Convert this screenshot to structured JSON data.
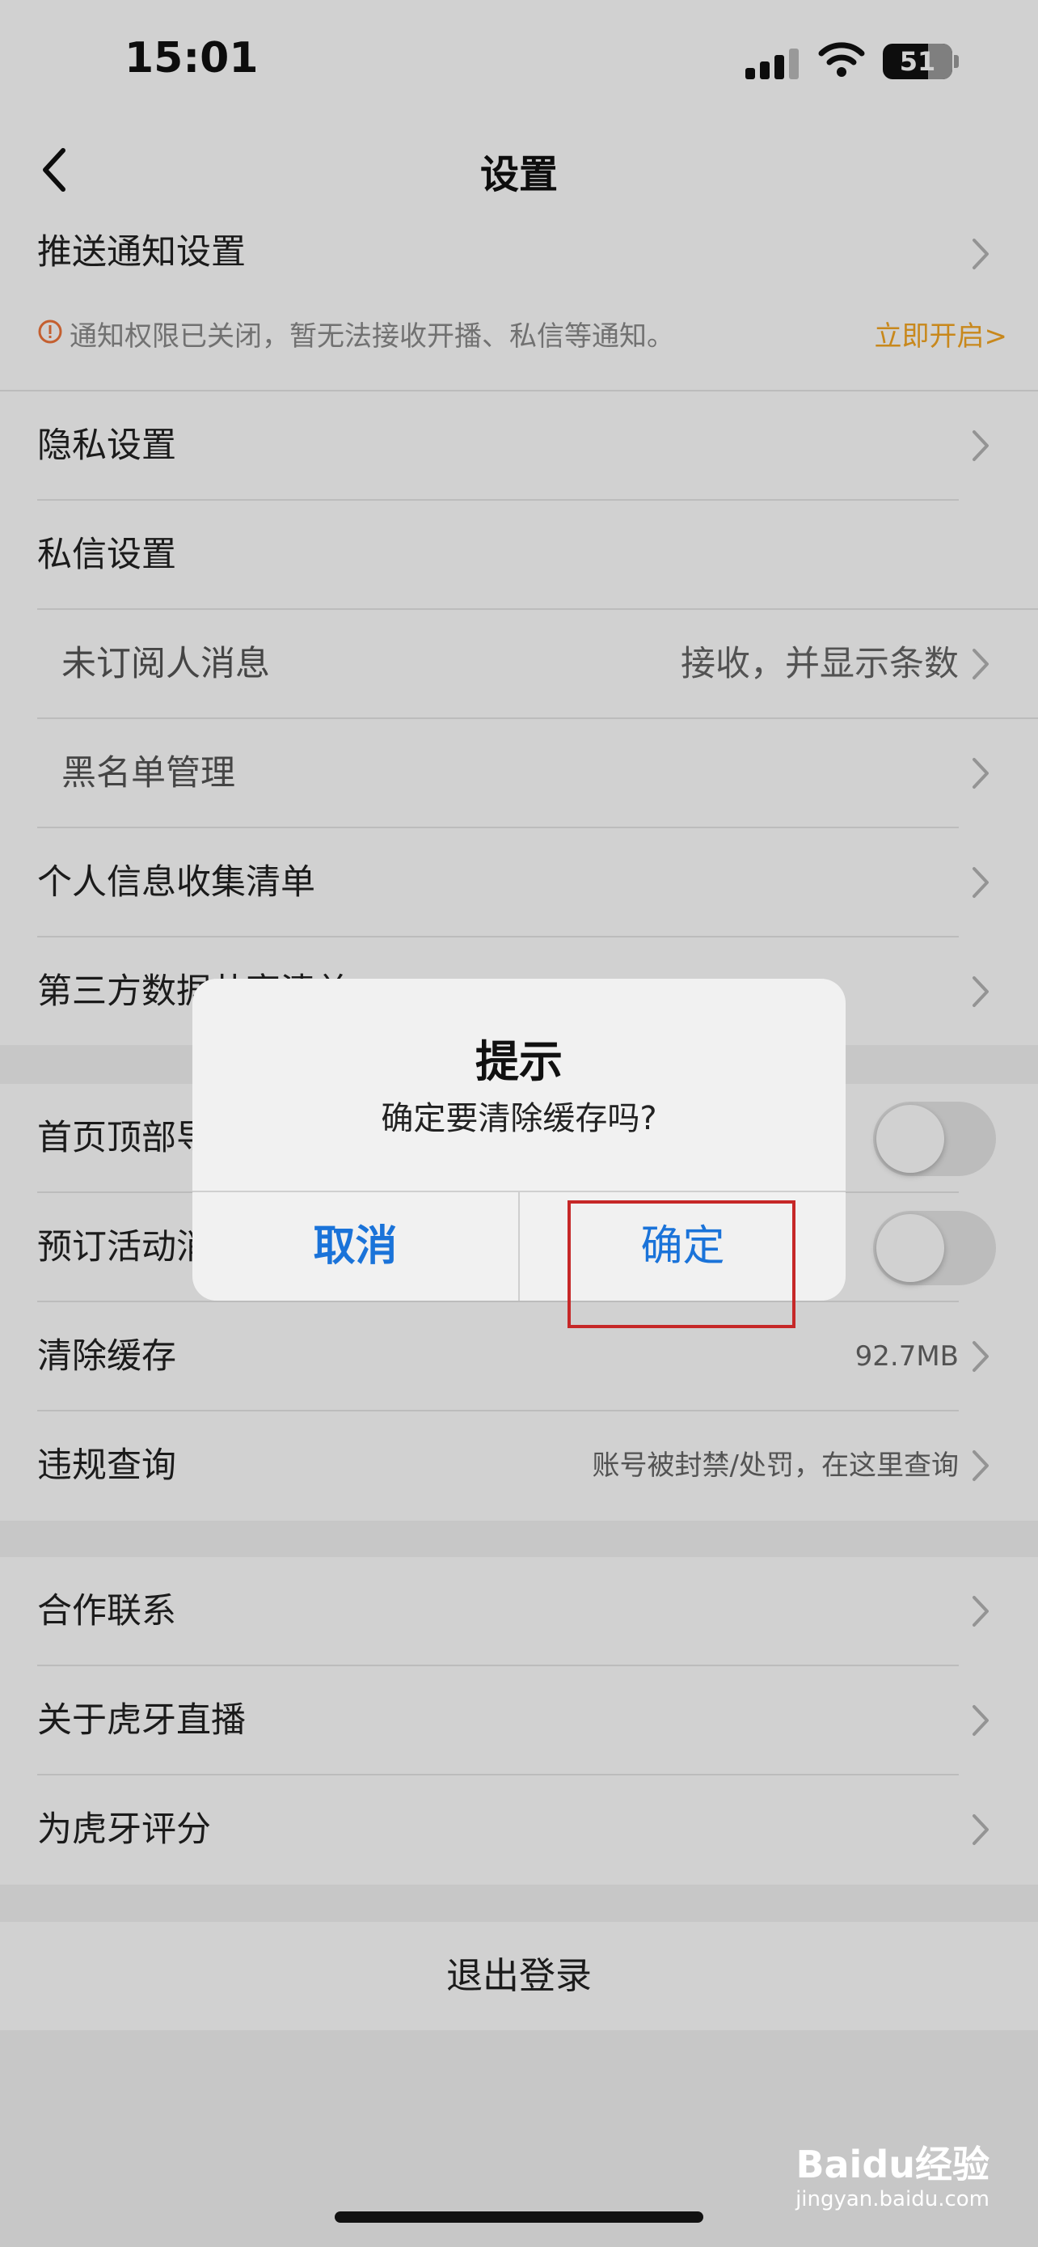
{
  "status_bar": {
    "time": "15:01",
    "battery": "51"
  },
  "nav": {
    "title": "设置"
  },
  "push_settings": {
    "label": "推送通知设置",
    "notice_text": "通知权限已关闭，暂无法接收开播、私信等通知。",
    "notice_link": "立即开启>"
  },
  "settings_rows": {
    "privacy": "隐私设置",
    "messages": "私信设置",
    "unsubscribed_messages": "未订阅人消息",
    "unsubscribed_messages_value": "接收，并显示条数",
    "blacklist": "黑名单管理",
    "personal_info_list": "个人信息收集清单",
    "third_party_data": "第三方数据共享清单",
    "homepage_top": "首页顶部导航",
    "booking_activity": "预订活动消息",
    "clear_cache": "清除缓存",
    "clear_cache_value": "92.7MB",
    "violation_query": "违规查询",
    "violation_query_value": "账号被封禁/处罚，在这里查询",
    "cooperation": "合作联系",
    "about": "关于虎牙直播",
    "rate": "为虎牙评分",
    "logout": "退出登录"
  },
  "dialog": {
    "title": "提示",
    "message": "确定要清除缓存吗?",
    "cancel": "取消",
    "confirm": "确定"
  },
  "watermark": {
    "logo": "Baidu经验",
    "url": "jingyan.baidu.com"
  },
  "colors": {
    "accent_blue": "#1a73d9",
    "warning_orange": "#f5a623",
    "highlight_red": "#c62828"
  }
}
